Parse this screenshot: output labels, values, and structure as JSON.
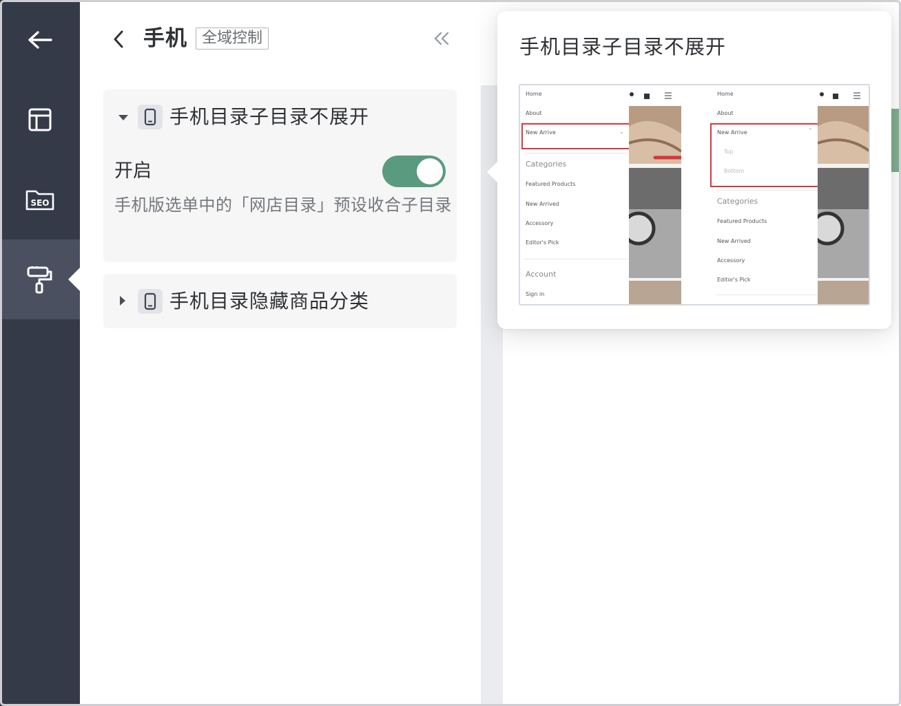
{
  "sidebar": {
    "items": [
      {
        "icon": "back-arrow-icon"
      },
      {
        "icon": "layout-icon"
      },
      {
        "icon": "seo-folder-icon",
        "label": "SEO"
      },
      {
        "icon": "paint-roller-icon",
        "active": true
      }
    ]
  },
  "header": {
    "title": "手机",
    "scope_tag": "全域控制"
  },
  "sections": [
    {
      "title": "手机目录子目录不展开",
      "expanded": true,
      "toggle_label": "开启",
      "toggle_on": true,
      "description": "手机版选单中的「网店目录」预设收合子目录"
    },
    {
      "title": "手机目录隐藏商品分类",
      "expanded": false
    }
  ],
  "tooltip": {
    "title": "手机目录子目录不展开",
    "preview": {
      "left_menu": {
        "items": [
          "Home",
          "About",
          "New Arrive"
        ],
        "categories_heading": "Categories",
        "category_items": [
          "Featured Products",
          "New Arrived",
          "Accessory",
          "Editor's Pick"
        ],
        "account_heading": "Account",
        "account_items": [
          "Sign in"
        ]
      },
      "right_menu": {
        "items": [
          "Home",
          "About",
          "New Arrive"
        ],
        "subitems": [
          "Top",
          "Bottom"
        ],
        "categories_heading": "Categories",
        "category_items": [
          "Featured Products",
          "New Arrived",
          "Accessory",
          "Editor's Pick"
        ]
      }
    }
  },
  "colors": {
    "rail_bg": "#353a48",
    "rail_active": "#4b5060",
    "toggle_on": "#5a9a7f",
    "highlight_red": "#d9363e"
  }
}
